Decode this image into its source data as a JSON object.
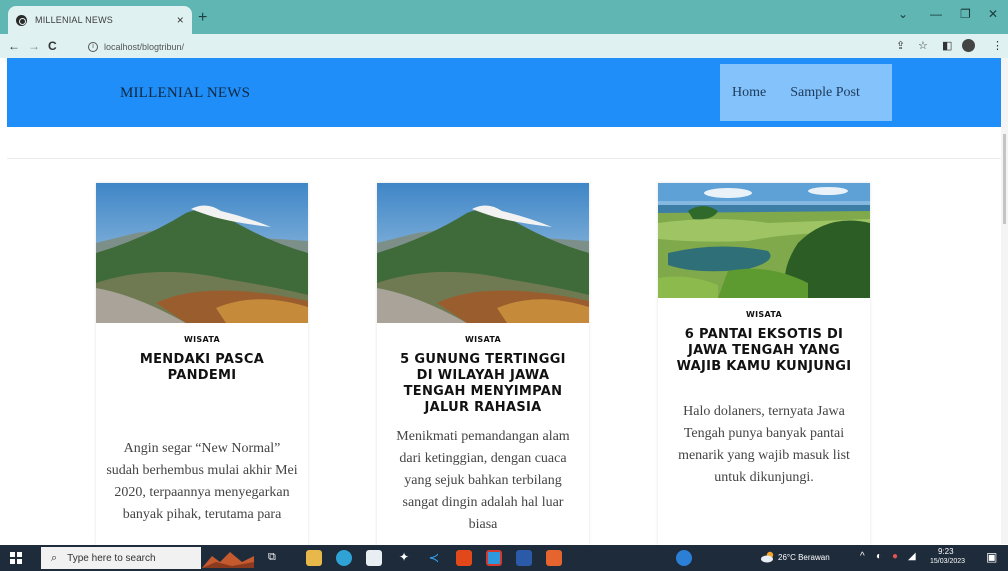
{
  "browser": {
    "tab_title": "MILLENIAL NEWS",
    "tab_close": "×",
    "new_tab": "+",
    "url": "localhost/blogtribun/"
  },
  "site": {
    "brand": "MILLENIAL NEWS",
    "nav": [
      "Home",
      "Sample Post"
    ]
  },
  "posts": [
    {
      "category": "WISATA",
      "title": "MENDAKI PASCA PANDEMI",
      "excerpt": "Angin segar “New Normal” sudah berhembus mulai akhir Mei 2020, terpaannya menyegarkan banyak pihak, terutama para",
      "image": "mountain"
    },
    {
      "category": "WISATA",
      "title": "5 GUNUNG TERTINGGI DI WILAYAH JAWA TENGAH MENYIMPAN JALUR RAHASIA",
      "excerpt": "Menikmati pemandangan alam dari ketinggian, dengan cuaca yang sejuk bahkan terbilang sangat dingin adalah hal luar biasa",
      "image": "mountain"
    },
    {
      "category": "WISATA",
      "title": "6 PANTAI EKSOTIS DI JAWA TENGAH YANG WAJIB KAMU KUNJUNGI",
      "excerpt": "Halo dolaners, ternyata Jawa Tengah punya banyak pantai menarik yang wajib masuk list untuk dikunjungi.",
      "image": "beach"
    }
  ],
  "taskbar": {
    "search_placeholder": "Type here to search",
    "weather": "26°C  Berawan",
    "time": "9:23",
    "date": "15/03/2023"
  },
  "colors": {
    "header": "#1f8ef9",
    "nav_bg": "#84c2fb",
    "chrome": "#5fb6b3",
    "taskbar": "#1d2b3b"
  }
}
